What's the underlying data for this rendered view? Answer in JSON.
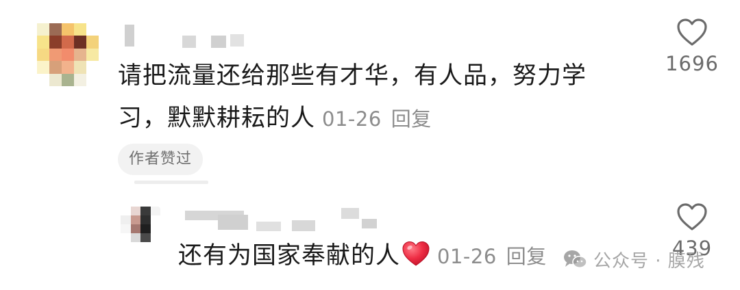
{
  "comment": {
    "text": "请把流量还给那些有才华，有人品，努力学习，默默耕耘的人",
    "date": "01-26",
    "reply_label": "回复",
    "author_liked_badge": "作者赞过",
    "likes": "1696"
  },
  "reply": {
    "text": "还有为国家奉献的人",
    "emoji": "red-heart-emoji",
    "date": "01-26",
    "reply_label": "回复",
    "likes": "439"
  },
  "watermark": {
    "icon": "wechat-icon",
    "text": "公众号 · 膜残"
  },
  "colors": {
    "text_primary": "#1a1a1a",
    "text_meta": "#8c8c8c",
    "badge_bg": "#f2f2f2",
    "heart_emoji": "#e8283c",
    "like_icon": "#6b6b6b"
  }
}
